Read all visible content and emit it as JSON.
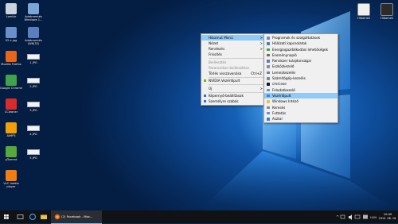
{
  "desktop_icons": [
    {
      "label": "Lomtár",
      "color": "#c9d4de"
    },
    {
      "label": "Adatmentés Windows 1...",
      "color": "#7aa6d6"
    },
    {
      "label": "92 e.jpg",
      "color": "#6a8fc9"
    },
    {
      "label": "Adatmentés (W8)32)",
      "color": "#5a7fbf"
    },
    {
      "label": "Mozilla Firefox",
      "color": "#e8661c"
    },
    {
      "label": "1.JPG",
      "color": "#ffffff"
    },
    {
      "label": "Google Chrome",
      "color": "#3fa34d"
    },
    {
      "label": "2.JPG",
      "color": "#ffffff"
    },
    {
      "label": "CCleaner",
      "color": "#d92b2b"
    },
    {
      "label": "3.JPG",
      "color": "#ffffff"
    },
    {
      "label": "AIMP3",
      "color": "#f2a007"
    },
    {
      "label": "4.JPG",
      "color": "#ffffff"
    },
    {
      "label": "µTorrent",
      "color": "#59a83a"
    },
    {
      "label": "5.JPG",
      "color": "#ffffff"
    },
    {
      "label": "VLC media player",
      "color": "#f07e10"
    }
  ],
  "right_icons": [
    {
      "label": "Hibamek",
      "color": "#f0f0f0"
    },
    {
      "label": "Hibamek",
      "color": "#2b2b2b"
    }
  ],
  "context_menu": {
    "items": [
      {
        "label": "Hibamut Menü",
        "arrow": ">",
        "highlighted": true
      },
      {
        "label": "Nézet",
        "arrow": ">"
      },
      {
        "label": "Rendezés",
        "arrow": ">"
      },
      {
        "label": "Frissítés"
      },
      {
        "sep": true
      },
      {
        "label": "Beillesztés",
        "disabled": true
      },
      {
        "label": "Parancsikon beillesztése",
        "disabled": true
      },
      {
        "label": "Törlés visszavonása",
        "shortcut": "Ctrl+Z"
      },
      {
        "sep": true
      },
      {
        "label": "NVIDIA Vezérlőpult",
        "icon_color": "#76b900"
      },
      {
        "sep": true
      },
      {
        "label": "Új",
        "arrow": ">"
      },
      {
        "sep": true
      },
      {
        "label": "Képernyő-beállítások",
        "icon_color": "#2b73d6"
      },
      {
        "label": "Személyre szabás",
        "icon_color": "#2b73d6"
      }
    ]
  },
  "submenu": {
    "items": [
      {
        "label": "Programok és szolgáltatások",
        "icon_color": "#6b8fb8"
      },
      {
        "label": "Hálózati kapcsolatok",
        "icon_color": "#4f7fb0"
      },
      {
        "label": "Energiagazdálkodási lehetőségek",
        "icon_color": "#3fa34d"
      },
      {
        "label": "Eseménynapló",
        "icon_color": "#7a6a5a"
      },
      {
        "label": "Rendszer tulajdonságai",
        "icon_color": "#5a7fbf"
      },
      {
        "label": "Eszközkezelő",
        "icon_color": "#8a8a9a"
      },
      {
        "label": "Lemezkezelés",
        "icon_color": "#6a7f9a"
      },
      {
        "label": "Számítógép-kezelés",
        "icon_color": "#7a8a9f"
      },
      {
        "label": "cmd.exe",
        "icon_color": "#1a1a1a"
      },
      {
        "label": "Feladatkezelő",
        "icon_color": "#5a9ad6"
      },
      {
        "label": "Vezérlőpult",
        "icon_color": "#3f7fcf",
        "highlighted": true
      },
      {
        "label": "Windows Intéző",
        "icon_color": "#e8c24a"
      },
      {
        "label": "Keresés",
        "icon_color": "#7a8a9a"
      },
      {
        "label": "Futtatás",
        "icon_color": "#6a8fbf"
      },
      {
        "label": "Asztal",
        "icon_color": "#3a7fd0"
      }
    ]
  },
  "taskbar": {
    "start_icon": "windows-logo-icon",
    "active_app_label": "(2) Facebook - Moz...",
    "clock_time": "10:49",
    "clock_date": "2015. 08. 16."
  }
}
